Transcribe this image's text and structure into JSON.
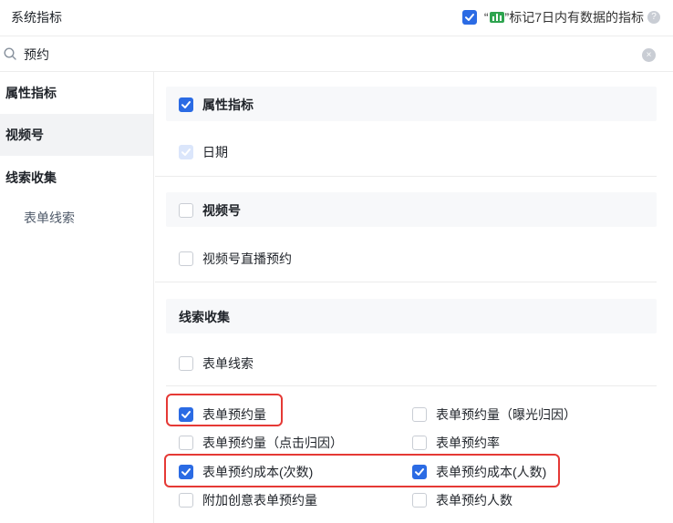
{
  "header": {
    "title": "系统指标",
    "mark_checked": true,
    "mark_prefix": "“",
    "mark_suffix": "”标记7日内有数据的指标",
    "help": "?"
  },
  "search": {
    "value": "预约",
    "clear": "×"
  },
  "sidebar": {
    "items": [
      {
        "label": "属性指标"
      },
      {
        "label": "视频号"
      },
      {
        "label": "线索收集"
      }
    ],
    "subitems": [
      {
        "label": "表单线索"
      }
    ]
  },
  "groups": [
    {
      "title": "属性指标",
      "title_checked": true,
      "items": [
        {
          "label": "日期",
          "checked": true,
          "disabled": true
        }
      ]
    },
    {
      "title": "视频号",
      "title_checked": false,
      "items": [
        {
          "label": "视频号直播预约",
          "checked": false
        }
      ]
    },
    {
      "title": "线索收集",
      "sub": {
        "label": "表单线索",
        "checked": false
      },
      "items": [
        {
          "label": "表单预约量",
          "checked": true
        },
        {
          "label": "表单预约量（曝光归因）",
          "checked": false
        },
        {
          "label": "表单预约量（点击归因）",
          "checked": false
        },
        {
          "label": "表单预约率",
          "checked": false
        },
        {
          "label": "表单预约成本(次数)",
          "checked": true
        },
        {
          "label": "表单预约成本(人数)",
          "checked": true
        },
        {
          "label": "附加创意表单预约量",
          "checked": false
        },
        {
          "label": "表单预约人数",
          "checked": false
        }
      ]
    }
  ],
  "colors": {
    "accent": "#2b6be4",
    "highlight": "#e53935",
    "badge": "#2ea44f"
  }
}
